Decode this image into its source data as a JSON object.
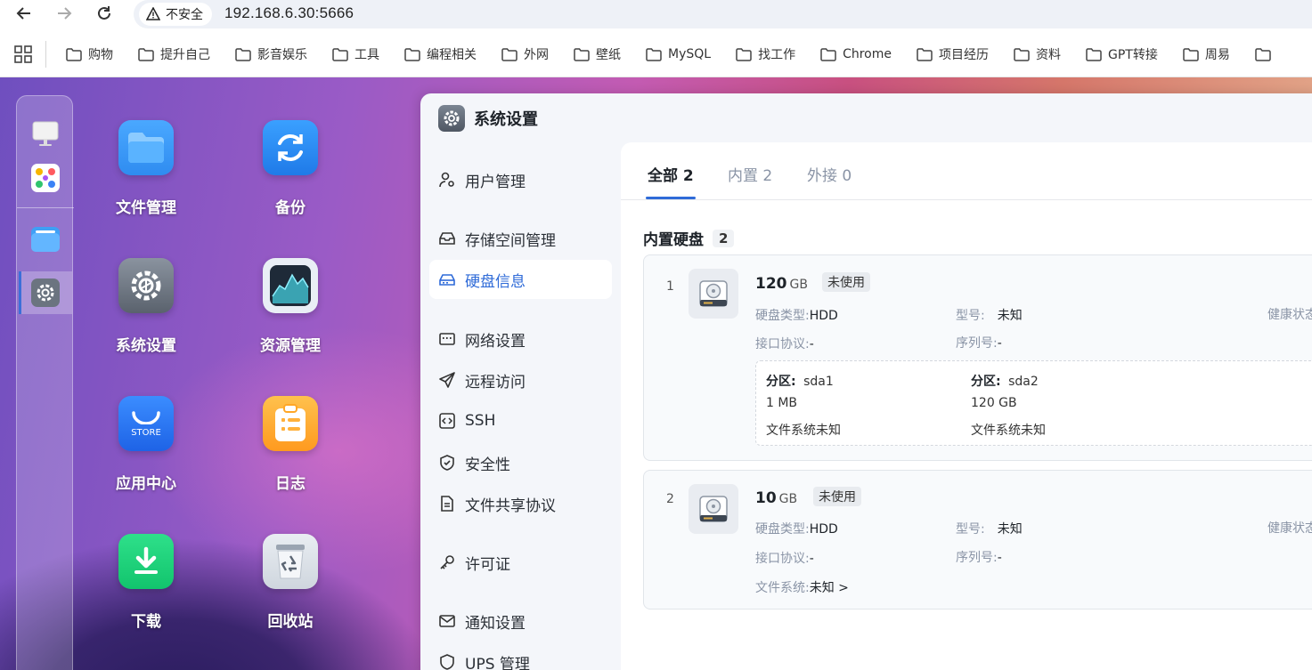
{
  "browser": {
    "security_label": "不安全",
    "url": "192.168.6.30:5666",
    "bookmarks": [
      "购物",
      "提升自己",
      "影音娱乐",
      "工具",
      "编程相关",
      "外网",
      "壁纸",
      "MySQL",
      "找工作",
      "Chrome",
      "项目经历",
      "资料",
      "GPT转接",
      "周易",
      ""
    ]
  },
  "desktop": {
    "apps": [
      {
        "label": "文件管理",
        "icon": "folder-icon"
      },
      {
        "label": "备份",
        "icon": "sync-icon"
      },
      {
        "label": "系统设置",
        "icon": "gear-icon"
      },
      {
        "label": "资源管理",
        "icon": "activity-chart-icon"
      },
      {
        "label": "应用中心",
        "icon": "store-icon",
        "badge": "STORE"
      },
      {
        "label": "日志",
        "icon": "log-icon"
      },
      {
        "label": "下载",
        "icon": "download-icon"
      },
      {
        "label": "回收站",
        "icon": "recycle-icon"
      }
    ]
  },
  "window": {
    "title": "系统设置",
    "sidebar": [
      {
        "label": "用户管理",
        "icon": "user-gear-icon"
      },
      {
        "label": "存储空间管理",
        "icon": "storage-icon"
      },
      {
        "label": "硬盘信息",
        "icon": "disk-icon",
        "active": true
      },
      {
        "label": "网络设置",
        "icon": "network-icon"
      },
      {
        "label": "远程访问",
        "icon": "send-icon"
      },
      {
        "label": "SSH",
        "icon": "code-icon"
      },
      {
        "label": "安全性",
        "icon": "shield-icon"
      },
      {
        "label": "文件共享协议",
        "icon": "document-icon"
      },
      {
        "label": "许可证",
        "icon": "key-icon"
      },
      {
        "label": "通知设置",
        "icon": "mail-icon"
      },
      {
        "label": "UPS 管理",
        "icon": "ups-shield-icon"
      }
    ],
    "tabs": [
      "全部 2",
      "内置 2",
      "外接 0"
    ],
    "section": {
      "title": "内置硬盘",
      "count": "2"
    },
    "labels": {
      "disk_type": "硬盘类型:",
      "model": "型号:",
      "health": "健康状态",
      "interface": "接口协议:",
      "serial": "序列号:",
      "filesystem": "文件系统:",
      "partition": "分区:"
    },
    "disks": [
      {
        "index": "1",
        "size": "120",
        "unit": "GB",
        "status": "未使用",
        "type": "HDD",
        "model": "未知",
        "interface": "-",
        "serial": "-",
        "partitions": [
          {
            "name": "sda1",
            "size": "1 MB",
            "fs": "文件系统未知"
          },
          {
            "name": "sda2",
            "size": "120 GB",
            "fs": "文件系统未知"
          }
        ]
      },
      {
        "index": "2",
        "size": "10",
        "unit": "GB",
        "status": "未使用",
        "type": "HDD",
        "model": "未知",
        "interface": "-",
        "serial": "-",
        "filesystem": "未知 >"
      }
    ]
  },
  "colors": {
    "accent": "#2f6bd8"
  }
}
